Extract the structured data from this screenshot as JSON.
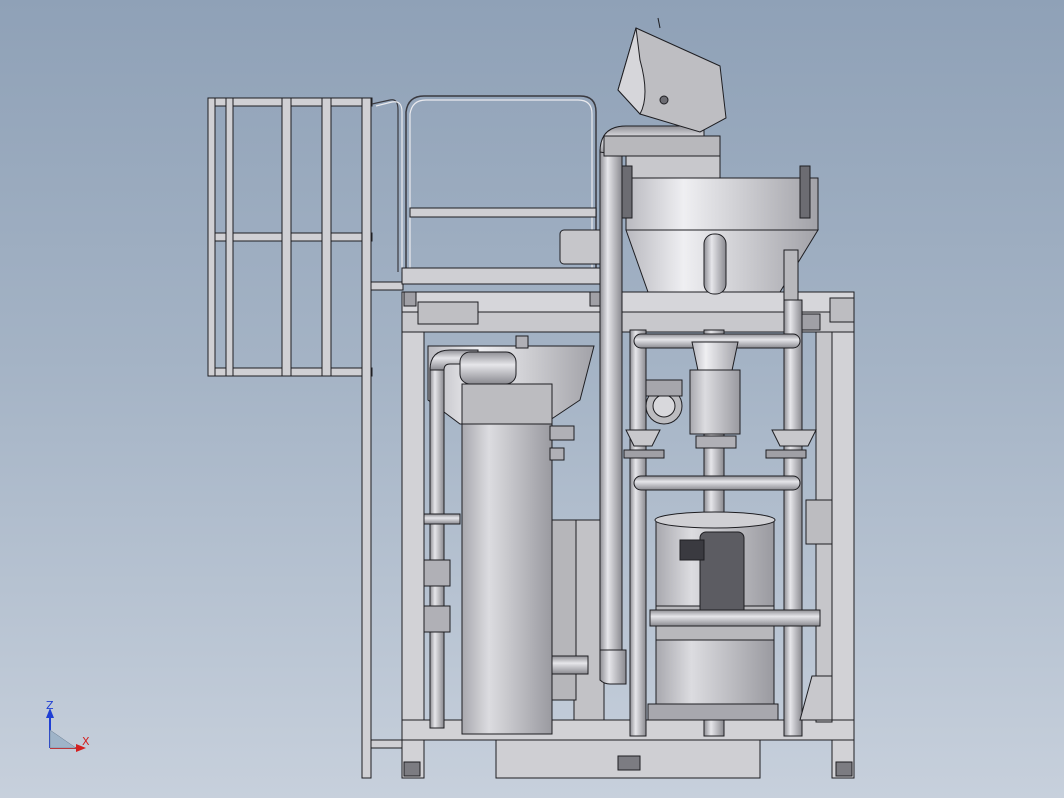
{
  "viewport": {
    "background_top": "#8fa1b7",
    "background_bottom": "#c7d0dc"
  },
  "triad": {
    "z_label": "Z",
    "x_label": "X",
    "z_color": "#1f3fd4",
    "x_color": "#d42020",
    "y_color": "#2aa02a"
  },
  "model": {
    "description_icon": "cad-assembly-icon",
    "metal_color": "#c4c4c8",
    "shadow_color": "#8c8c92",
    "edge_color": "#1e1e22"
  }
}
